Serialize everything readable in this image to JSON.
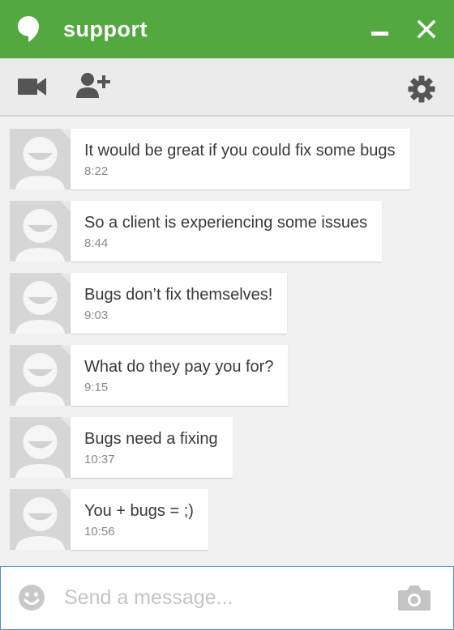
{
  "window": {
    "title": "support",
    "accent_color": "#53a93f",
    "icons": [
      "hangouts-logo-icon",
      "minimize-icon",
      "close-icon"
    ]
  },
  "toolbar": {
    "icons": [
      "video-call-icon",
      "add-person-icon",
      "settings-icon"
    ]
  },
  "messages": [
    {
      "text": "It would be great if you could fix some bugs",
      "time": "8:22"
    },
    {
      "text": "So a client is experiencing some issues",
      "time": "8:44"
    },
    {
      "text": "Bugs don’t fix themselves!",
      "time": "9:03"
    },
    {
      "text": "What do they pay you for?",
      "time": "9:15"
    },
    {
      "text": "Bugs need a fixing",
      "time": "10:37"
    },
    {
      "text": "You + bugs = ;)",
      "time": "10:56"
    }
  ],
  "composer": {
    "placeholder": "Send a message...",
    "value": "",
    "icons": [
      "emoji-icon",
      "camera-icon"
    ]
  }
}
